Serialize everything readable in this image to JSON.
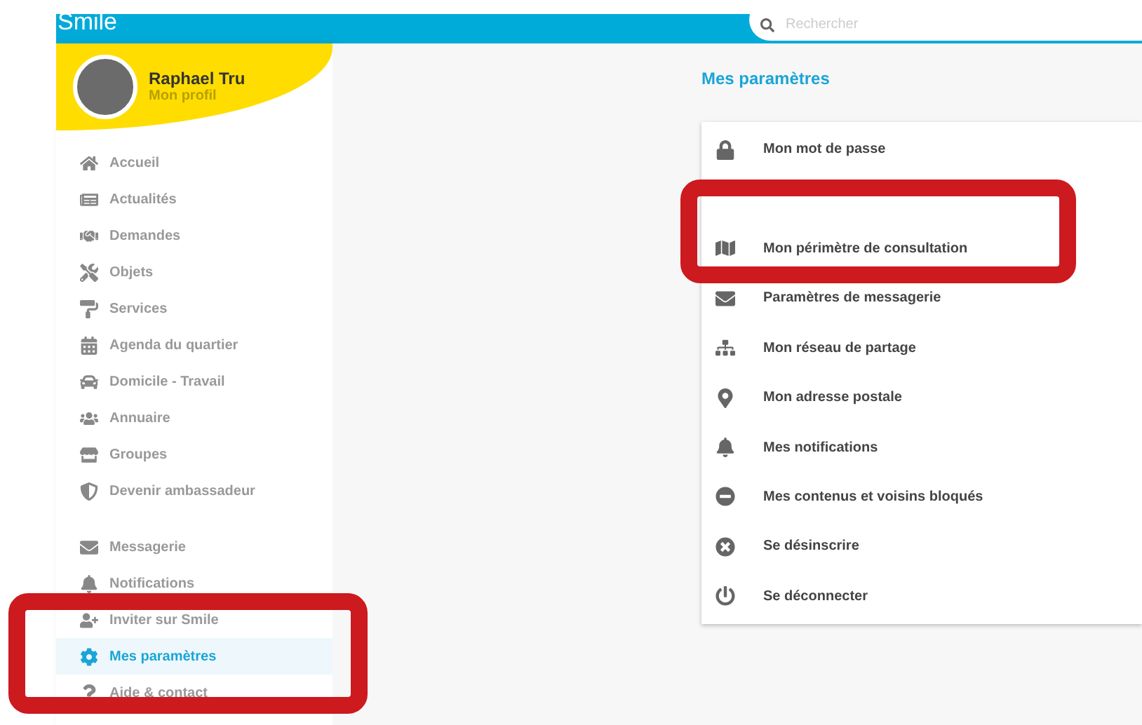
{
  "header": {
    "logo": "Smile",
    "search": {
      "placeholder": "Rechercher"
    }
  },
  "profile": {
    "name": "Raphael Tru",
    "link": "Mon profil"
  },
  "sidebar": {
    "groups": [
      {
        "items": [
          {
            "label": "Accueil",
            "selected": false
          },
          {
            "label": "Actualités",
            "selected": false
          },
          {
            "label": "Demandes",
            "selected": false
          },
          {
            "label": "Objets",
            "selected": false
          },
          {
            "label": "Services",
            "selected": false
          },
          {
            "label": "Agenda du quartier",
            "selected": false
          },
          {
            "label": "Domicile - Travail",
            "selected": false
          },
          {
            "label": "Annuaire",
            "selected": false
          },
          {
            "label": "Groupes",
            "selected": false
          },
          {
            "label": "Devenir ambassadeur",
            "selected": false
          }
        ]
      },
      {
        "items": [
          {
            "label": "Messagerie",
            "selected": false
          },
          {
            "label": "Notifications",
            "selected": false
          },
          {
            "label": "Inviter sur Smile",
            "selected": false
          },
          {
            "label": "Mes paramètres",
            "selected": true
          },
          {
            "label": "Aide & contact",
            "selected": false
          }
        ]
      }
    ]
  },
  "settings": {
    "title": "Mes paramètres",
    "items": [
      {
        "label": "Mon mot de passe"
      },
      {
        "kind": "blank"
      },
      {
        "label": "Mon périmètre de consultation"
      },
      {
        "label": "Paramètres de messagerie"
      },
      {
        "label": "Mon réseau de partage"
      },
      {
        "label": "Mon adresse postale"
      },
      {
        "label": "Mes notifications"
      },
      {
        "label": "Mes contenus et voisins bloqués"
      },
      {
        "label": "Se désinscrire"
      },
      {
        "label": "Se déconnecter"
      }
    ]
  }
}
